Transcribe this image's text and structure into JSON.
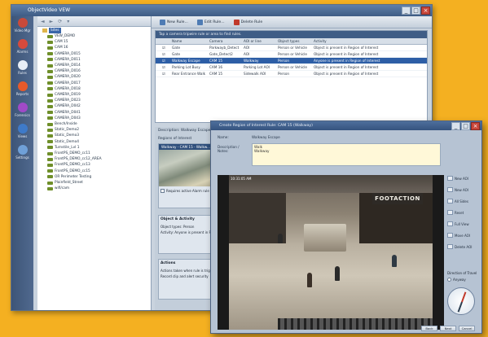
{
  "main_window": {
    "title": "ObjectVideo VEW",
    "buttons": [
      "_",
      "□",
      "×"
    ]
  },
  "left_nav": {
    "items": [
      {
        "label": "Video Mgr",
        "icon": "camera-icon",
        "color": "#c94a3a"
      },
      {
        "label": "Alarms",
        "icon": "alarm-icon",
        "color": "#d64a3c"
      },
      {
        "label": "Rules",
        "icon": "rules-icon",
        "color": "#e8eef6"
      },
      {
        "label": "Reports",
        "icon": "reports-icon",
        "color": "#e85a2a"
      },
      {
        "label": "Forensics",
        "icon": "forensics-icon",
        "color": "#a04ac8"
      },
      {
        "label": "Views",
        "icon": "views-icon",
        "color": "#3e7ac9"
      },
      {
        "label": "Settings",
        "icon": "settings-icon",
        "color": "#6fa0d8"
      }
    ]
  },
  "tree": {
    "toolbar": [
      "◄",
      "►",
      "⟳",
      "▾"
    ],
    "root": "Sites",
    "items": [
      "VEW_DEMO",
      "CAM 15",
      "CAM 16",
      "CAMERA_D015",
      "CAMERA_D011",
      "CAMERA_D014",
      "CAMERA_D016",
      "CAMERA_D020",
      "CAMERA_D017",
      "CAMERA_D018",
      "CAMERA_D019",
      "CAMERA_D023",
      "CAMERA_D042",
      "CAMERA_D041",
      "CAMERA_D043",
      "Bench/Inside",
      "Static_Demo2",
      "Static_Demo3",
      "Static_Demo4",
      "Turnstile_Lvl 1",
      "FrontPS_DEMO_cc11",
      "FrontPS_DEMO_cc12_AREA",
      "FrontPS_DEMO_cc13",
      "FrontPS_DEMO_cc15",
      "OR Perimeter Testing",
      "Plainfield_Street",
      "wifi/cam"
    ]
  },
  "toolbar": {
    "new_rule": "New Rule...",
    "edit_rule": "Edit Rule...",
    "delete_rule": "Delete Rule"
  },
  "rules_table": {
    "hint": "Tap a camera tripwire rule or area to find rules.",
    "columns": [
      "",
      "Name",
      "Camera",
      "AOI or line",
      "Object types",
      "Activity"
    ],
    "rows": [
      [
        "☑",
        "Gate",
        "Parkwayb_Detect",
        "AOI",
        "Person or Vehicle",
        "Object is present in Region of Interest"
      ],
      [
        "☑",
        "Gate",
        "Gate_Detect2",
        "AOI",
        "Person or Vehicle",
        "Object is present in Region of Interest"
      ],
      [
        "☑",
        "Walkway Escape",
        "CAM 15",
        "Walkway",
        "Person",
        "Anyone is present in Region of Interest"
      ],
      [
        "☑",
        "Parking Lot Busy",
        "CAM 16",
        "Parking Lot AOI",
        "Person or Vehicle",
        "Object is present in Region of Interest"
      ],
      [
        "☑",
        "Rear Entrance Walk",
        "CAM 15",
        "Sidewalk AOI",
        "Person",
        "Object is present in Region of Interest"
      ]
    ],
    "selected_row": 2
  },
  "detail": {
    "description_label": "Description: Walkway Escape",
    "region_label": "Regions of Interest",
    "thumb_title": "Walkway - CAM 15 - Walkw...",
    "checkbox_label": "Requires active Alarm rule",
    "objects_title": "Object & Activity",
    "object_types": "Object types: Person",
    "activity": "Activity: Anyone is present in Region",
    "actions_title": "Actions",
    "actions_text1": "Actions taken when rule is triggered",
    "actions_text2": "Record clip and alert security"
  },
  "dialog": {
    "title": "Create Region of Interest Rule: CAM 15 (Walkway)",
    "name_label": "Name:",
    "name_value": "Walkway Escape",
    "desc_label": "Description / Notes:",
    "desc_value": "Walk\nWalkway",
    "video_timestamp": "10:31:05 AM",
    "store_sign": "FOOTACTION",
    "side_buttons": [
      "New AOI",
      "New AOI",
      "All Sides",
      "Reset",
      "Full View",
      "Move AOI",
      "Delete AOI"
    ],
    "direction_label": "Direction of Travel",
    "direction_option": "Anyway",
    "buttons": [
      "Back",
      "Next",
      "Cancel"
    ]
  }
}
